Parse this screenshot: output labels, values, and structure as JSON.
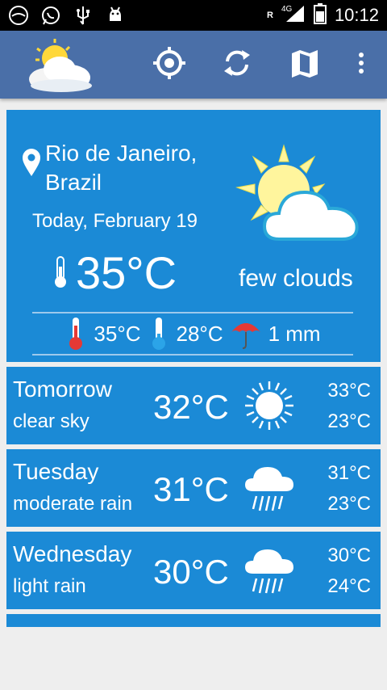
{
  "statusbar": {
    "time": "10:12",
    "network": "4G",
    "roaming": "R",
    "left_icons": [
      "app-icon",
      "whatsapp-icon",
      "usb-icon",
      "android-icon"
    ],
    "right_icons": [
      "signal-icon",
      "battery-icon"
    ]
  },
  "appbar": {
    "actions": [
      "locate-icon",
      "refresh-icon",
      "map-icon",
      "overflow-menu-icon"
    ]
  },
  "current": {
    "city": "Rio de Janeiro, Brazil",
    "date": "Today, February 19",
    "temp": "35°C",
    "description": "few clouds",
    "high": "35°C",
    "low": "28°C",
    "rain": "1 mm",
    "icon": "sun-cloud-icon"
  },
  "forecast": [
    {
      "day": "Tomorrow",
      "desc": "clear sky",
      "temp": "32°C",
      "max": "33°C",
      "min": "23°C",
      "icon": "sun-icon"
    },
    {
      "day": "Tuesday",
      "desc": "moderate rain",
      "temp": "31°C",
      "max": "31°C",
      "min": "23°C",
      "icon": "rain-cloud-icon"
    },
    {
      "day": "Wednesday",
      "desc": "light rain",
      "temp": "30°C",
      "max": "30°C",
      "min": "24°C",
      "icon": "rain-cloud-icon"
    }
  ],
  "colors": {
    "appbar": "#4a6fa8",
    "card": "#1b8ad6",
    "background": "#eeeeee"
  }
}
